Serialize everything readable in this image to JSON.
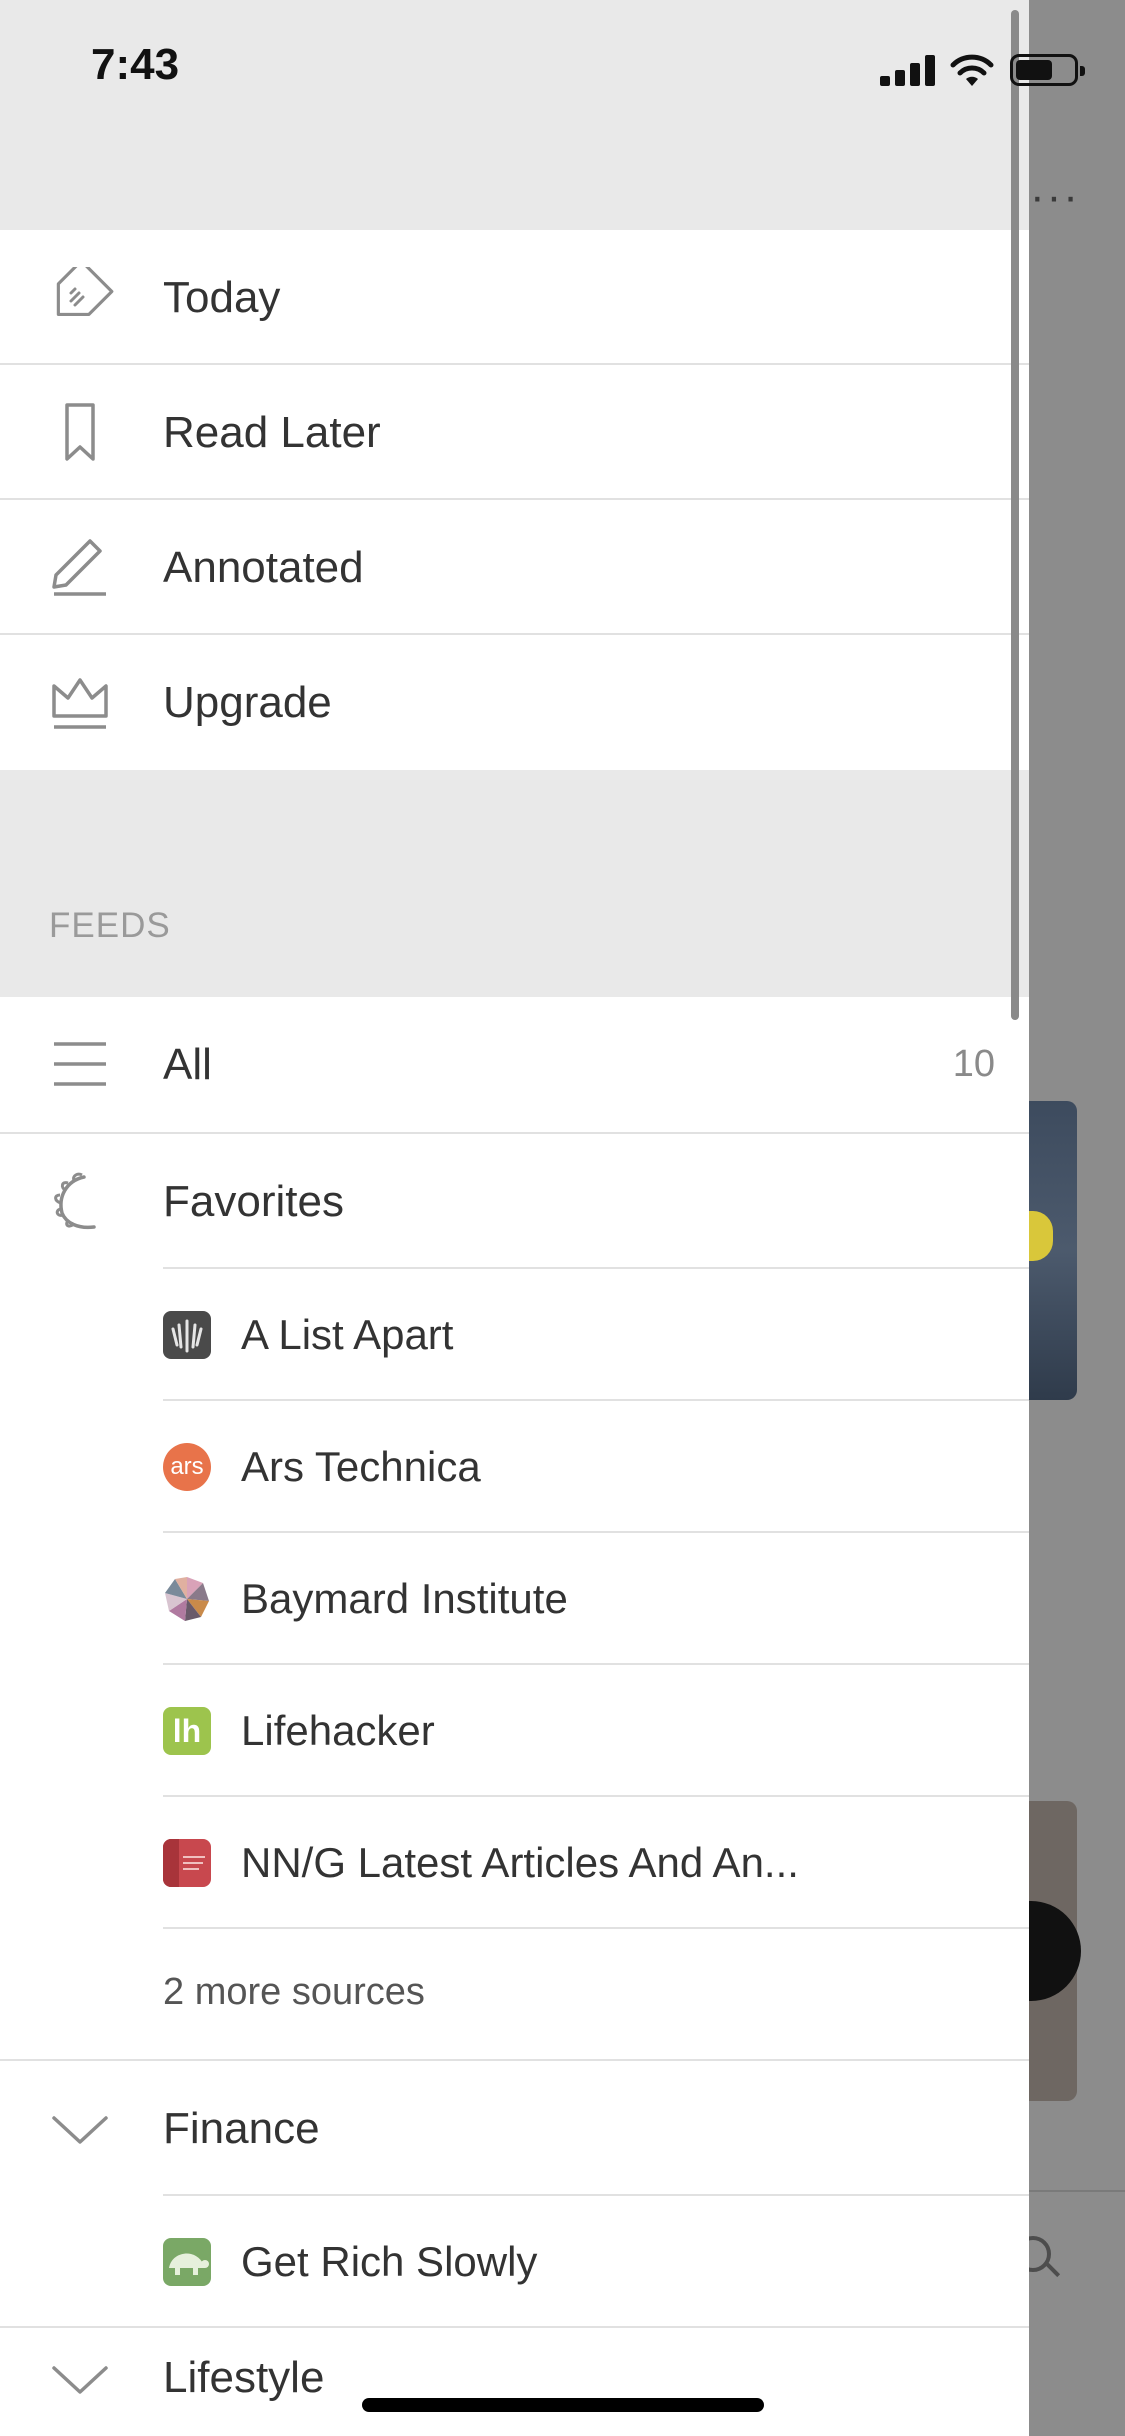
{
  "status_bar": {
    "time": "7:43"
  },
  "nav": [
    {
      "label": "Today",
      "icon": "today-tag-icon"
    },
    {
      "label": "Read Later",
      "icon": "bookmark-icon"
    },
    {
      "label": "Annotated",
      "icon": "pencil-icon"
    },
    {
      "label": "Upgrade",
      "icon": "crown-icon"
    }
  ],
  "feeds": {
    "section_title": "FEEDS",
    "all": {
      "label": "All",
      "count": "10",
      "icon": "list-icon"
    },
    "favorites": {
      "label": "Favorites",
      "icon": "laurel-icon",
      "sources": [
        {
          "label": "A List Apart",
          "icon": "a-list-apart-favicon",
          "color": "#4a4a4a"
        },
        {
          "label": "Ars Technica",
          "icon": "ars-technica-favicon",
          "text": "ars",
          "color": "#e8734a"
        },
        {
          "label": "Baymard Institute",
          "icon": "baymard-favicon"
        },
        {
          "label": "Lifehacker",
          "icon": "lifehacker-favicon",
          "text": "lh",
          "color": "#9dc44d"
        },
        {
          "label": "NN/G Latest Articles And An...",
          "icon": "nng-favicon",
          "color": "#c8484e"
        }
      ],
      "more": "2 more sources"
    },
    "finance": {
      "label": "Finance",
      "icon": "chevron-down-icon",
      "sources": [
        {
          "label": "Get Rich Slowly",
          "icon": "get-rich-slowly-favicon",
          "color": "#7aa866"
        }
      ]
    },
    "lifestyle": {
      "label": "Lifestyle",
      "icon": "chevron-down-icon"
    }
  }
}
